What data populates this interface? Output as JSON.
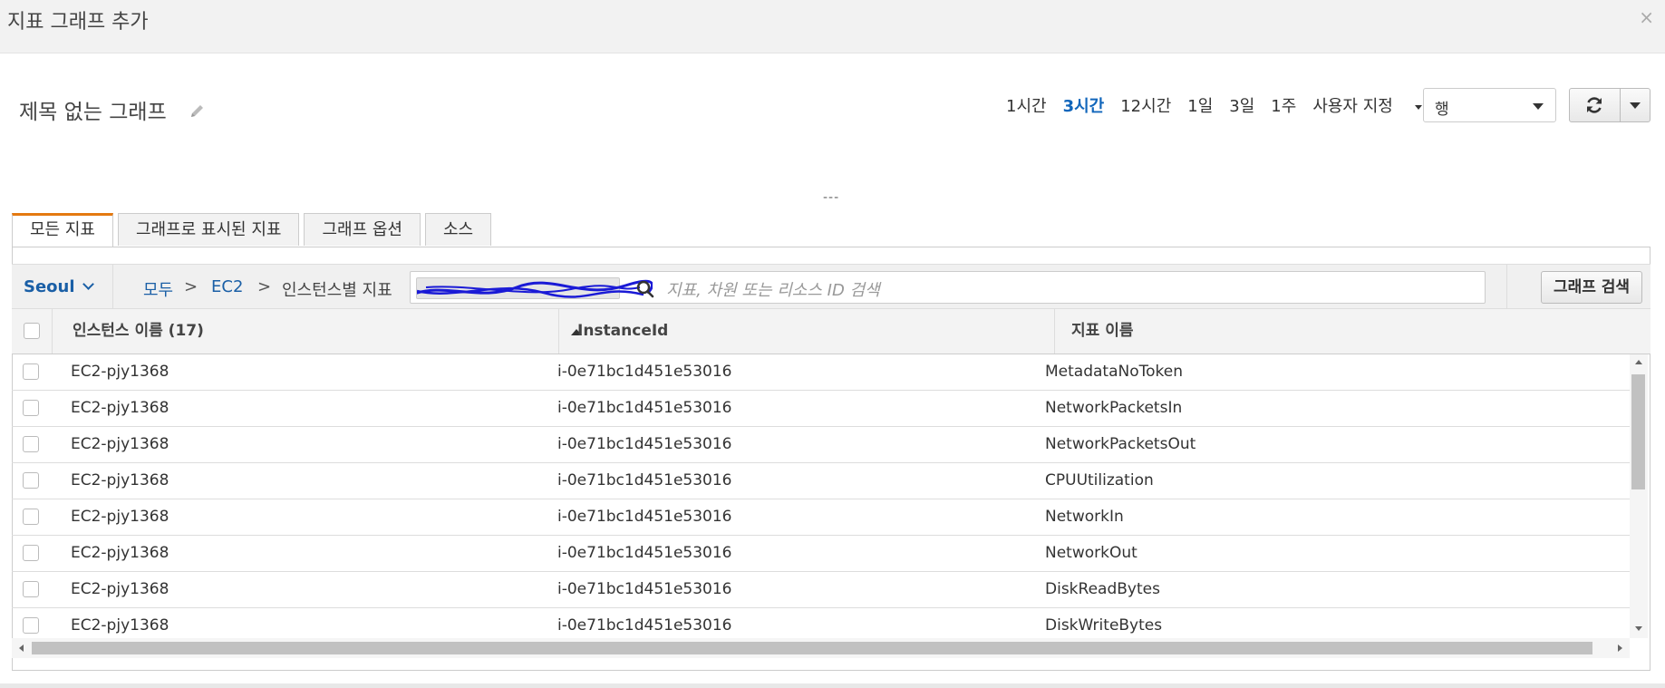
{
  "dialog": {
    "title": "지표 그래프 추가",
    "close_icon": "×"
  },
  "graph": {
    "title": "제목 없는 그래프"
  },
  "time_ranges": [
    {
      "label": "1시간",
      "active": false
    },
    {
      "label": "3시간",
      "active": true
    },
    {
      "label": "12시간",
      "active": false
    },
    {
      "label": "1일",
      "active": false
    },
    {
      "label": "3일",
      "active": false
    },
    {
      "label": "1주",
      "active": false
    },
    {
      "label": "사용자 지정",
      "active": false
    }
  ],
  "view_select": {
    "value": "행"
  },
  "divider": "---",
  "tabs": [
    {
      "label": "모든 지표",
      "active": true
    },
    {
      "label": "그래프로 표시된 지표",
      "active": false
    },
    {
      "label": "그래프 옵션",
      "active": false
    },
    {
      "label": "소스",
      "active": false
    }
  ],
  "filter": {
    "region": "Seoul",
    "breadcrumb": [
      "모두",
      "EC2",
      "인스턴스별 지표"
    ],
    "breadcrumb_sep": ">",
    "search_placeholder": "지표, 차원 또는 리소스 ID 검색",
    "search_button": "그래프 검색"
  },
  "table": {
    "columns": [
      "인스턴스 이름 (17)",
      "InstanceId",
      "지표 이름"
    ],
    "rows": [
      [
        "EC2-pjy1368",
        "i-0e71bc1d451e53016",
        "MetadataNoToken"
      ],
      [
        "EC2-pjy1368",
        "i-0e71bc1d451e53016",
        "NetworkPacketsIn"
      ],
      [
        "EC2-pjy1368",
        "i-0e71bc1d451e53016",
        "NetworkPacketsOut"
      ],
      [
        "EC2-pjy1368",
        "i-0e71bc1d451e53016",
        "CPUUtilization"
      ],
      [
        "EC2-pjy1368",
        "i-0e71bc1d451e53016",
        "NetworkIn"
      ],
      [
        "EC2-pjy1368",
        "i-0e71bc1d451e53016",
        "NetworkOut"
      ],
      [
        "EC2-pjy1368",
        "i-0e71bc1d451e53016",
        "DiskReadBytes"
      ],
      [
        "EC2-pjy1368",
        "i-0e71bc1d451e53016",
        "DiskWriteBytes"
      ]
    ]
  },
  "colors": {
    "accent_tab": "#e47911",
    "link": "#1a5fa6",
    "active_range": "#1166bb"
  }
}
